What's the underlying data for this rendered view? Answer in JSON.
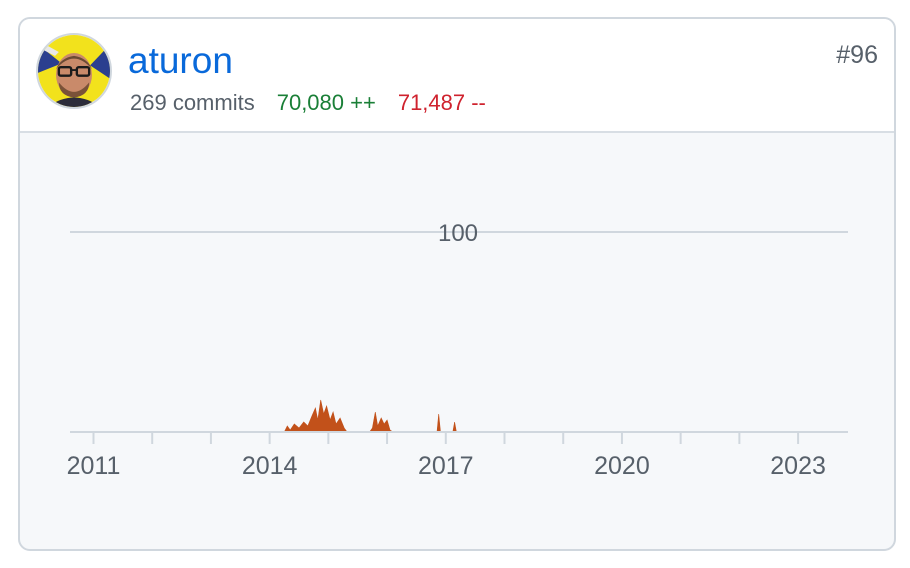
{
  "contributor": {
    "username": "aturon",
    "avatar_icon": "avatar-photo",
    "commits_text": "269 commits",
    "additions_text": "70,080 ++",
    "deletions_text": "71,487 --",
    "rank": "#96"
  },
  "colors": {
    "link": "#0969da",
    "additions": "#1a7f37",
    "deletions": "#cf222e",
    "area_fill": "#c2511a",
    "text_muted": "#57606a",
    "gridline": "#d0d7de",
    "chart_bg": "#f6f8fa"
  },
  "chart_data": {
    "type": "area",
    "title": "",
    "xlabel": "",
    "ylabel": "",
    "x_ticks": [
      "2011",
      "2014",
      "2017",
      "2020",
      "2023"
    ],
    "y_ticks": [
      100
    ],
    "xlim": [
      2010.6,
      2023.85
    ],
    "ylim": [
      0,
      140
    ],
    "grid": true,
    "series": [
      {
        "values": [
          {
            "x": 2014.25,
            "y": 0
          },
          {
            "x": 2014.3,
            "y": 3
          },
          {
            "x": 2014.35,
            "y": 1
          },
          {
            "x": 2014.42,
            "y": 4
          },
          {
            "x": 2014.5,
            "y": 2
          },
          {
            "x": 2014.58,
            "y": 5
          },
          {
            "x": 2014.65,
            "y": 3
          },
          {
            "x": 2014.72,
            "y": 8
          },
          {
            "x": 2014.78,
            "y": 12
          },
          {
            "x": 2014.82,
            "y": 6
          },
          {
            "x": 2014.87,
            "y": 16
          },
          {
            "x": 2014.92,
            "y": 9
          },
          {
            "x": 2014.97,
            "y": 13
          },
          {
            "x": 2015.03,
            "y": 6
          },
          {
            "x": 2015.08,
            "y": 10
          },
          {
            "x": 2015.13,
            "y": 4
          },
          {
            "x": 2015.2,
            "y": 7
          },
          {
            "x": 2015.27,
            "y": 2
          },
          {
            "x": 2015.32,
            "y": 0
          },
          {
            "x": 2015.7,
            "y": 0
          },
          {
            "x": 2015.75,
            "y": 2
          },
          {
            "x": 2015.8,
            "y": 10
          },
          {
            "x": 2015.84,
            "y": 3
          },
          {
            "x": 2015.9,
            "y": 7
          },
          {
            "x": 2015.95,
            "y": 4
          },
          {
            "x": 2016.0,
            "y": 6
          },
          {
            "x": 2016.05,
            "y": 1
          },
          {
            "x": 2016.1,
            "y": 0
          },
          {
            "x": 2016.85,
            "y": 0
          },
          {
            "x": 2016.88,
            "y": 9
          },
          {
            "x": 2016.91,
            "y": 0
          },
          {
            "x": 2017.12,
            "y": 0
          },
          {
            "x": 2017.15,
            "y": 5
          },
          {
            "x": 2017.18,
            "y": 0
          }
        ]
      }
    ]
  }
}
